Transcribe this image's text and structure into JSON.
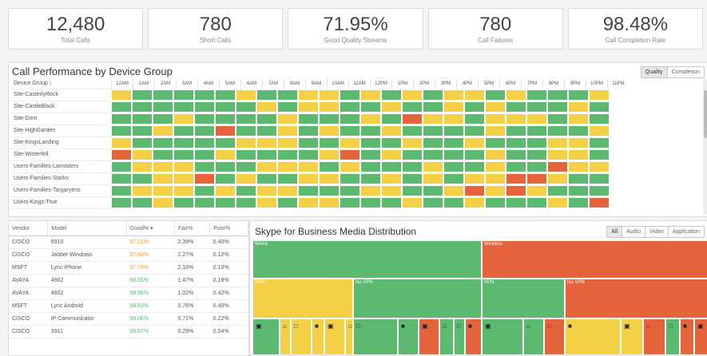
{
  "kpis": [
    {
      "value": "12,480",
      "label": "Total Calls"
    },
    {
      "value": "780",
      "label": "Short Calls"
    },
    {
      "value": "71.95%",
      "label": "Good Quality Streams"
    },
    {
      "value": "780",
      "label": "Call Failures"
    },
    {
      "value": "98.48%",
      "label": "Call Completion Rate"
    }
  ],
  "performance": {
    "title": "Call Performance by Device Group",
    "toggle": [
      "Quality",
      "Completion"
    ],
    "group_header": "Device Group",
    "hours": [
      "12AM",
      "1AM",
      "2AM",
      "3AM",
      "4AM",
      "5AM",
      "6AM",
      "7AM",
      "8AM",
      "9AM",
      "10AM",
      "11AM",
      "12PM",
      "1PM",
      "2PM",
      "3PM",
      "4PM",
      "5PM",
      "6PM",
      "7PM",
      "8PM",
      "9PM",
      "10PM",
      "11PM"
    ],
    "rows": [
      {
        "name": "Site-CasterlyRock",
        "cells": "ygggggyggyygygygyygygggy"
      },
      {
        "name": "Site-CastleBlack",
        "cells": "gggggggygyyggyggygygggyg"
      },
      {
        "name": "Site-Dorn",
        "cells": "gggyggggygggygryygyyygyg"
      },
      {
        "name": "Site-HighGarden",
        "cells": "ggyggrggygyggyggggyggggy"
      },
      {
        "name": "Site-KingsLanding",
        "cells": "ygggggyyyggyggyggygggyyg"
      },
      {
        "name": "Site-Winterfell",
        "cells": "rygggyggggyrgyggggyggyyg"
      },
      {
        "name": "Users-Families-Lannisters",
        "cells": "gyyygggyyygygggyggyggryy"
      },
      {
        "name": "Users-Families-Starks",
        "cells": "ggyyrgyggyyggygygyyrrygg"
      },
      {
        "name": "Users-Families-Targaryens",
        "cells": "gyyygygyygggyyggyryryggg"
      },
      {
        "name": "Users-Kings-True",
        "cells": "ggyggggygyygggyggygggygr"
      }
    ]
  },
  "vendors": {
    "headers": [
      "Vendor",
      "Model",
      "Good%",
      "Fair%",
      "Poor%"
    ],
    "rows": [
      [
        "CISCO",
        "6910",
        "97.21%",
        "2.39%",
        "0.40%"
      ],
      [
        "CISCO",
        "Jabber Windows",
        "97.60%",
        "2.27%",
        "0.12%"
      ],
      [
        "MSFT",
        "Lync iPhone",
        "97.74%",
        "2.16%",
        "0.10%"
      ],
      [
        "AVAYA",
        "4902",
        "98.35%",
        "1.47%",
        "0.18%"
      ],
      [
        "AVAYA",
        "4602",
        "98.56%",
        "1.02%",
        "0.42%"
      ],
      [
        "MSFT",
        "Lync Android",
        "98.83%",
        "0.76%",
        "0.40%"
      ],
      [
        "CISCO",
        "IP Communicator",
        "99.06%",
        "0.71%",
        "0.22%"
      ],
      [
        "CISCO",
        "3911",
        "99.67%",
        "0.29%",
        "0.04%"
      ]
    ]
  },
  "media": {
    "title": "Skype for Business Media Distribution",
    "toggle": [
      "All",
      "Audio",
      "Video",
      "Application"
    ],
    "blocks": [
      {
        "label": "Wired",
        "color": "#5bba6f"
      },
      {
        "label": "Wireless",
        "color": "#e5643c"
      },
      {
        "label": "VPN",
        "color": "#f3d046"
      },
      {
        "label": "No VPN",
        "color": "#5bba6f"
      },
      {
        "label": "VPN",
        "color": "#5bba6f"
      },
      {
        "label": "No VPN",
        "color": "#e5643c"
      }
    ]
  },
  "colors": {
    "good": "#5bba6f",
    "fair": "#f3d046",
    "poor": "#e5643c"
  }
}
